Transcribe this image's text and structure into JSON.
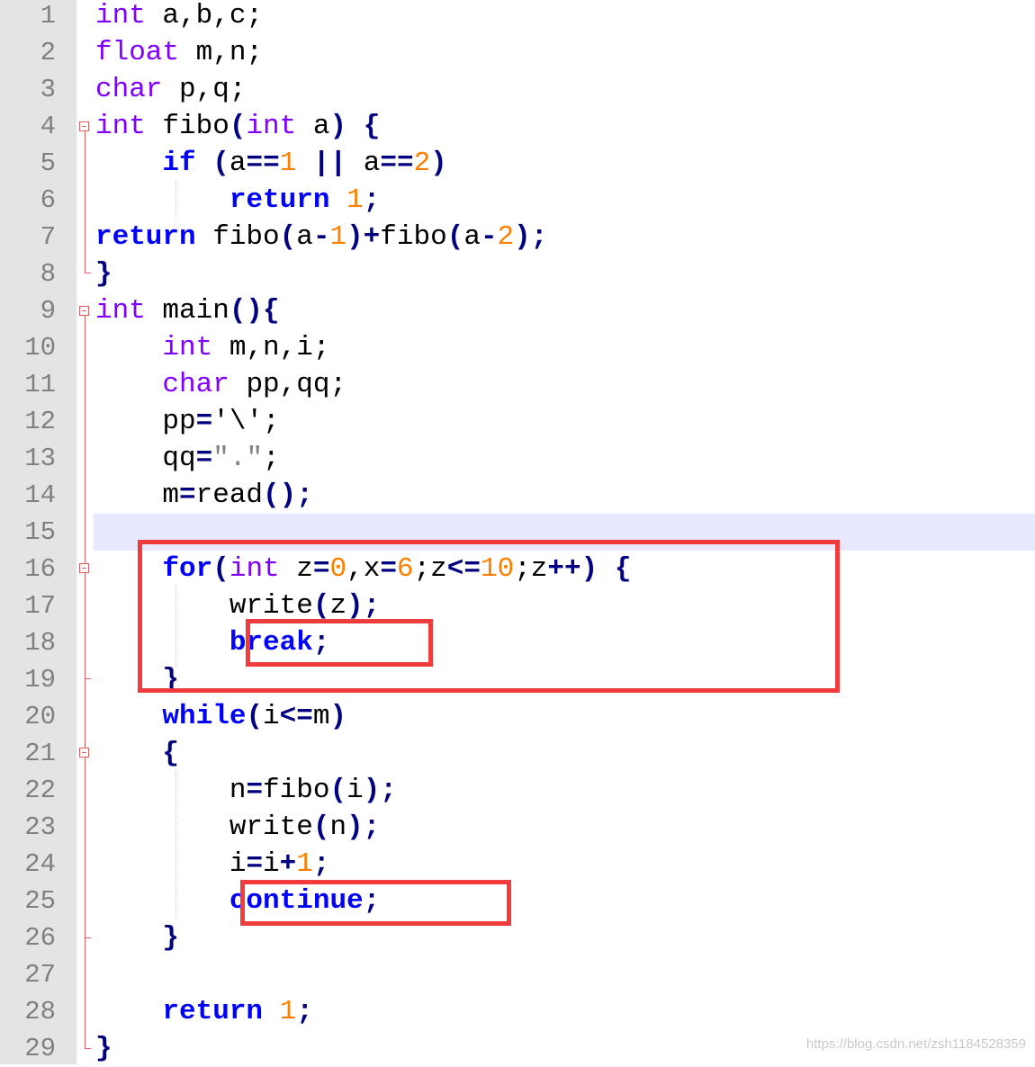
{
  "editor": {
    "lines": [
      {
        "n": "1",
        "tokens": [
          [
            "t-type",
            "int"
          ],
          [
            "t-id",
            " a,b,c;"
          ]
        ]
      },
      {
        "n": "2",
        "tokens": [
          [
            "t-type",
            "float"
          ],
          [
            "t-id",
            " m,n;"
          ]
        ]
      },
      {
        "n": "3",
        "tokens": [
          [
            "t-type",
            "char"
          ],
          [
            "t-id",
            " p,q;"
          ]
        ]
      },
      {
        "n": "4",
        "tokens": [
          [
            "t-type",
            "int"
          ],
          [
            "t-id",
            " fibo"
          ],
          [
            "t-op",
            "("
          ],
          [
            "t-type",
            "int"
          ],
          [
            "t-id",
            " a"
          ],
          [
            "t-op",
            ")"
          ],
          [
            "t-id",
            " "
          ],
          [
            "t-op",
            "{"
          ]
        ]
      },
      {
        "n": "5",
        "tokens": [
          [
            "t-id",
            "    "
          ],
          [
            "t-kw",
            "if"
          ],
          [
            "t-id",
            " "
          ],
          [
            "t-op",
            "("
          ],
          [
            "t-id",
            "a"
          ],
          [
            "t-op",
            "=="
          ],
          [
            "t-num",
            "1"
          ],
          [
            "t-id",
            " "
          ],
          [
            "t-op",
            "||"
          ],
          [
            "t-id",
            " a"
          ],
          [
            "t-op",
            "=="
          ],
          [
            "t-num",
            "2"
          ],
          [
            "t-op",
            ")"
          ]
        ]
      },
      {
        "n": "6",
        "tokens": [
          [
            "t-id",
            "        "
          ],
          [
            "t-kw",
            "return"
          ],
          [
            "t-id",
            " "
          ],
          [
            "t-num",
            "1"
          ],
          [
            "t-op",
            ";"
          ]
        ]
      },
      {
        "n": "7",
        "tokens": [
          [
            "t-kw",
            "return"
          ],
          [
            "t-id",
            " fibo"
          ],
          [
            "t-op",
            "("
          ],
          [
            "t-id",
            "a"
          ],
          [
            "t-op",
            "-"
          ],
          [
            "t-num",
            "1"
          ],
          [
            "t-op",
            ")+"
          ],
          [
            "t-id",
            "fibo"
          ],
          [
            "t-op",
            "("
          ],
          [
            "t-id",
            "a"
          ],
          [
            "t-op",
            "-"
          ],
          [
            "t-num",
            "2"
          ],
          [
            "t-op",
            ");"
          ]
        ]
      },
      {
        "n": "8",
        "tokens": [
          [
            "t-op",
            "}"
          ]
        ]
      },
      {
        "n": "9",
        "tokens": [
          [
            "t-type",
            "int"
          ],
          [
            "t-id",
            " main"
          ],
          [
            "t-op",
            "(){"
          ]
        ]
      },
      {
        "n": "10",
        "tokens": [
          [
            "t-id",
            "    "
          ],
          [
            "t-type",
            "int"
          ],
          [
            "t-id",
            " m,n,i;"
          ]
        ]
      },
      {
        "n": "11",
        "tokens": [
          [
            "t-id",
            "    "
          ],
          [
            "t-type",
            "char"
          ],
          [
            "t-id",
            " pp,qq;"
          ]
        ]
      },
      {
        "n": "12",
        "tokens": [
          [
            "t-id",
            "    pp"
          ],
          [
            "t-op",
            "="
          ],
          [
            "t-id",
            "'\\';"
          ]
        ]
      },
      {
        "n": "13",
        "tokens": [
          [
            "t-id",
            "    qq"
          ],
          [
            "t-op",
            "="
          ],
          [
            "t-str",
            "\".\""
          ],
          [
            "t-id",
            ";"
          ]
        ]
      },
      {
        "n": "14",
        "tokens": [
          [
            "t-id",
            "    m"
          ],
          [
            "t-op",
            "="
          ],
          [
            "t-id",
            "read"
          ],
          [
            "t-op",
            "();"
          ]
        ]
      },
      {
        "n": "15",
        "tokens": []
      },
      {
        "n": "16",
        "tokens": [
          [
            "t-id",
            "    "
          ],
          [
            "t-kw",
            "for"
          ],
          [
            "t-op",
            "("
          ],
          [
            "t-type",
            "int"
          ],
          [
            "t-id",
            " z"
          ],
          [
            "t-op",
            "="
          ],
          [
            "t-num",
            "0"
          ],
          [
            "t-id",
            ",x"
          ],
          [
            "t-op",
            "="
          ],
          [
            "t-num",
            "6"
          ],
          [
            "t-id",
            ";z"
          ],
          [
            "t-op",
            "<="
          ],
          [
            "t-num",
            "10"
          ],
          [
            "t-id",
            ";z"
          ],
          [
            "t-op",
            "++)"
          ],
          [
            "t-id",
            " "
          ],
          [
            "t-op",
            "{"
          ]
        ]
      },
      {
        "n": "17",
        "tokens": [
          [
            "t-id",
            "        write"
          ],
          [
            "t-op",
            "("
          ],
          [
            "t-id",
            "z"
          ],
          [
            "t-op",
            ");"
          ]
        ]
      },
      {
        "n": "18",
        "tokens": [
          [
            "t-id",
            "        "
          ],
          [
            "t-kw",
            "break"
          ],
          [
            "t-op",
            ";"
          ]
        ]
      },
      {
        "n": "19",
        "tokens": [
          [
            "t-id",
            "    "
          ],
          [
            "t-op",
            "}"
          ]
        ]
      },
      {
        "n": "20",
        "tokens": [
          [
            "t-id",
            "    "
          ],
          [
            "t-kw",
            "while"
          ],
          [
            "t-op",
            "("
          ],
          [
            "t-id",
            "i"
          ],
          [
            "t-op",
            "<="
          ],
          [
            "t-id",
            "m"
          ],
          [
            "t-op",
            ")"
          ]
        ]
      },
      {
        "n": "21",
        "tokens": [
          [
            "t-id",
            "    "
          ],
          [
            "t-op",
            "{"
          ]
        ]
      },
      {
        "n": "22",
        "tokens": [
          [
            "t-id",
            "        n"
          ],
          [
            "t-op",
            "="
          ],
          [
            "t-id",
            "fibo"
          ],
          [
            "t-op",
            "("
          ],
          [
            "t-id",
            "i"
          ],
          [
            "t-op",
            ");"
          ]
        ]
      },
      {
        "n": "23",
        "tokens": [
          [
            "t-id",
            "        write"
          ],
          [
            "t-op",
            "("
          ],
          [
            "t-id",
            "n"
          ],
          [
            "t-op",
            ");"
          ]
        ]
      },
      {
        "n": "24",
        "tokens": [
          [
            "t-id",
            "        i"
          ],
          [
            "t-op",
            "="
          ],
          [
            "t-id",
            "i"
          ],
          [
            "t-op",
            "+"
          ],
          [
            "t-num",
            "1"
          ],
          [
            "t-op",
            ";"
          ]
        ]
      },
      {
        "n": "25",
        "tokens": [
          [
            "t-id",
            "        "
          ],
          [
            "t-kw",
            "continue"
          ],
          [
            "t-op",
            ";"
          ]
        ]
      },
      {
        "n": "26",
        "tokens": [
          [
            "t-id",
            "    "
          ],
          [
            "t-op",
            "}"
          ]
        ]
      },
      {
        "n": "27",
        "tokens": []
      },
      {
        "n": "28",
        "tokens": [
          [
            "t-id",
            "    "
          ],
          [
            "t-kw",
            "return"
          ],
          [
            "t-id",
            " "
          ],
          [
            "t-num",
            "1"
          ],
          [
            "t-op",
            ";"
          ]
        ]
      },
      {
        "n": "29",
        "tokens": [
          [
            "t-op",
            "}"
          ]
        ]
      }
    ],
    "current_line": "15",
    "fold_markers": [
      "4",
      "9",
      "16",
      "21"
    ]
  },
  "colors": {
    "type": "#8000ff",
    "keyword": "#0000ff",
    "number": "#ff8000",
    "operator": "#000080",
    "highlight_box": "#f03c3c",
    "current_line": "#e8e8ff"
  },
  "watermark": "https://blog.csdn.net/zsh1184528359"
}
